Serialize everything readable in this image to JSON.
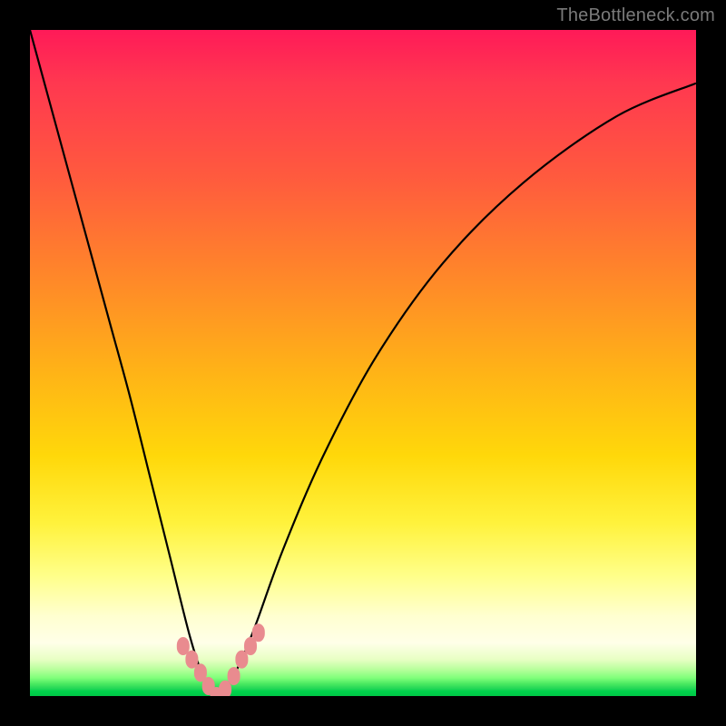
{
  "watermark": "TheBottleneck.com",
  "colors": {
    "curve": "#000000",
    "marker": "#e98b8f",
    "frame": "#000000"
  },
  "chart_data": {
    "type": "line",
    "title": "",
    "xlabel": "",
    "ylabel": "",
    "xlim": [
      0,
      1
    ],
    "ylim": [
      0,
      1
    ],
    "grid": false,
    "legend": false,
    "note": "Axes are unlabeled; x and y normalized 0–1. y is 'bottleneck' (0 at bottom/green, 1 at top/red). Minimum of curve occurs near x≈0.28.",
    "series": [
      {
        "name": "bottleneck-curve",
        "x": [
          0.0,
          0.03,
          0.06,
          0.09,
          0.12,
          0.15,
          0.18,
          0.21,
          0.24,
          0.26,
          0.28,
          0.3,
          0.32,
          0.34,
          0.38,
          0.44,
          0.52,
          0.62,
          0.74,
          0.88,
          1.0
        ],
        "y": [
          1.0,
          0.89,
          0.78,
          0.67,
          0.56,
          0.45,
          0.33,
          0.21,
          0.09,
          0.03,
          0.0,
          0.02,
          0.06,
          0.11,
          0.22,
          0.36,
          0.51,
          0.65,
          0.77,
          0.87,
          0.92
        ]
      }
    ],
    "markers": {
      "name": "highlight-segment",
      "x": [
        0.23,
        0.243,
        0.256,
        0.268,
        0.28,
        0.293,
        0.306,
        0.318,
        0.331,
        0.343
      ],
      "y": [
        0.075,
        0.055,
        0.035,
        0.015,
        0.0,
        0.01,
        0.03,
        0.055,
        0.075,
        0.095
      ]
    }
  }
}
